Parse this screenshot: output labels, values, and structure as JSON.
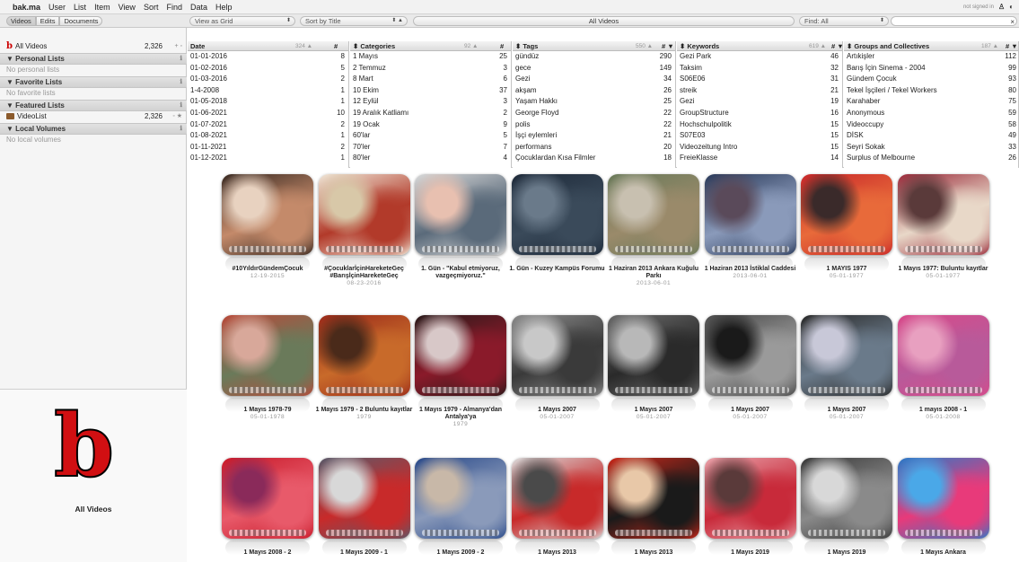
{
  "menubar": {
    "app": "bak.ma",
    "menus": [
      "User",
      "List",
      "Item",
      "View",
      "Sort",
      "Find",
      "Data",
      "Help"
    ],
    "status": "not signed in"
  },
  "toolbar": {
    "tabs": [
      "Videos",
      "Edits",
      "Documents"
    ],
    "view_select": "View as Grid",
    "sort_select": "Sort by Title",
    "list_title": "All Videos",
    "find_select": "Find: All"
  },
  "sidebar": {
    "all_videos": {
      "label": "All Videos",
      "count": "2,326"
    },
    "personal_header": "Personal Lists",
    "personal_empty": "No personal lists",
    "favorite_header": "Favorite Lists",
    "favorite_empty": "No favorite lists",
    "featured_header": "Featured Lists",
    "videolist": {
      "label": "VideoList",
      "count": "2,326"
    },
    "volumes_header": "Local Volumes",
    "volumes_empty": "No local volumes",
    "preview_letter": "b",
    "preview_caption": "All Videos"
  },
  "browser": {
    "columns": [
      {
        "title": "Date",
        "total": "324",
        "rows": [
          {
            "label": "01-01-2016",
            "count": "8"
          },
          {
            "label": "01-02-2016",
            "count": "5"
          },
          {
            "label": "01-03-2016",
            "count": "2"
          },
          {
            "label": "1-4-2008",
            "count": "1"
          },
          {
            "label": "01-05-2018",
            "count": "1"
          },
          {
            "label": "01-06-2021",
            "count": "10"
          },
          {
            "label": "01-07-2021",
            "count": "2"
          },
          {
            "label": "01-08-2021",
            "count": "1"
          },
          {
            "label": "01-11-2021",
            "count": "2"
          },
          {
            "label": "01-12-2021",
            "count": "1"
          }
        ]
      },
      {
        "title": "Categories",
        "total": "92",
        "rows": [
          {
            "label": "1 Mayıs",
            "count": "25"
          },
          {
            "label": "2 Temmuz",
            "count": "3"
          },
          {
            "label": "8 Mart",
            "count": "6"
          },
          {
            "label": "10 Ekim",
            "count": "37"
          },
          {
            "label": "12 Eylül",
            "count": "3"
          },
          {
            "label": "19 Aralık Katliamı",
            "count": "2"
          },
          {
            "label": "19 Ocak",
            "count": "9"
          },
          {
            "label": "60'lar",
            "count": "5"
          },
          {
            "label": "70'ler",
            "count": "7"
          },
          {
            "label": "80'ler",
            "count": "4"
          }
        ]
      },
      {
        "title": "Tags",
        "total": "550",
        "rows": [
          {
            "label": "gündüz",
            "count": "290"
          },
          {
            "label": "gece",
            "count": "149"
          },
          {
            "label": "Gezi",
            "count": "34"
          },
          {
            "label": "akşam",
            "count": "26"
          },
          {
            "label": "Yaşam Hakkı",
            "count": "25"
          },
          {
            "label": "George Floyd",
            "count": "22"
          },
          {
            "label": "polis",
            "count": "22"
          },
          {
            "label": "İşçi eylemleri",
            "count": "21"
          },
          {
            "label": "performans",
            "count": "20"
          },
          {
            "label": "Çocuklardan Kısa Filmler",
            "count": "18"
          }
        ]
      },
      {
        "title": "Keywords",
        "total": "619",
        "rows": [
          {
            "label": "Gezi Park",
            "count": "46"
          },
          {
            "label": "Taksim",
            "count": "32"
          },
          {
            "label": "S06E06",
            "count": "31"
          },
          {
            "label": "streik",
            "count": "21"
          },
          {
            "label": "Gezi",
            "count": "19"
          },
          {
            "label": "GroupStructure",
            "count": "16"
          },
          {
            "label": "Hochschulpolitik",
            "count": "15"
          },
          {
            "label": "S07E03",
            "count": "15"
          },
          {
            "label": "Videozeitung Intro",
            "count": "15"
          },
          {
            "label": "FreieKlasse",
            "count": "14"
          }
        ]
      },
      {
        "title": "Groups and Collectives",
        "total": "187",
        "rows": [
          {
            "label": "Artıkişler",
            "count": "112"
          },
          {
            "label": "Barış İçin Sinema - 2004",
            "count": "99"
          },
          {
            "label": "Gündem Çocuk",
            "count": "93"
          },
          {
            "label": "Tekel İşçileri / Tekel Workers",
            "count": "80"
          },
          {
            "label": "Karahaber",
            "count": "75"
          },
          {
            "label": "Anonymous",
            "count": "59"
          },
          {
            "label": "Videoccupy",
            "count": "58"
          },
          {
            "label": "DİSK",
            "count": "49"
          },
          {
            "label": "Seyri Sokak",
            "count": "33"
          },
          {
            "label": "Surplus of Melbourne",
            "count": "26"
          }
        ]
      }
    ]
  },
  "grid": {
    "items": [
      {
        "title": "#10YıldırGündemÇocuk",
        "date": "12-19-2015",
        "colors": [
          "#3a2a22",
          "#c48a6a",
          "#e8d2c0"
        ]
      },
      {
        "title": "#ÇocuklarİçinHareketeGeç #BarışİçinHareketeGeç",
        "date": "08-23-2016",
        "colors": [
          "#efe6d6",
          "#b23a2a",
          "#d8c8a8"
        ]
      },
      {
        "title": "1. Gün - \"Kabul etmiyoruz, vazgeçmiyoruz.\"",
        "date": "",
        "colors": [
          "#d8d8d8",
          "#5a6a7a",
          "#e8c0b0"
        ]
      },
      {
        "title": "1. Gün - Kuzey Kampüs Forumu",
        "date": "",
        "colors": [
          "#1e2a3a",
          "#3a4a5a",
          "#6a7a8a"
        ]
      },
      {
        "title": "1 Haziran 2013 Ankara Kuğulu Parkı",
        "date": "2013-06-01",
        "colors": [
          "#6a7a5a",
          "#9a8a6a",
          "#c8c0b0"
        ]
      },
      {
        "title": "1 Haziran 2013 İstiklal Caddesi",
        "date": "2013-06-01",
        "colors": [
          "#2a3a5a",
          "#8a9aba",
          "#5a4a5a"
        ]
      },
      {
        "title": "1 MAYIS 1977",
        "date": "05-01-1977",
        "colors": [
          "#c8282a",
          "#e86a3a",
          "#3a2a2a"
        ]
      },
      {
        "title": "1 Mayıs 1977: Buluntu kayıtlar",
        "date": "05-01-1977",
        "colors": [
          "#9a2a3a",
          "#e8d8c8",
          "#5a3a3a"
        ]
      },
      {
        "title": "1 Mayıs 1978-79",
        "date": "05-01-1978",
        "colors": [
          "#b84a3a",
          "#6a7a5a",
          "#d8a89a"
        ]
      },
      {
        "title": "1 Mayıs 1979 - 2 Buluntu kayıtlar",
        "date": "1979",
        "colors": [
          "#9a2a1a",
          "#c86a2a",
          "#4a2a1a"
        ]
      },
      {
        "title": "1 Mayıs 1979 - Almanya'dan Antalya'ya",
        "date": "1979",
        "colors": [
          "#2a1a1a",
          "#8a1a2a",
          "#d8c8c8"
        ]
      },
      {
        "title": "1 Mayıs 2007",
        "date": "05-01-2007",
        "colors": [
          "#8a8a8a",
          "#3a3a3a",
          "#c8c8c8"
        ]
      },
      {
        "title": "1 Mayıs 2007",
        "date": "05-01-2007",
        "colors": [
          "#6a6a6a",
          "#2a2a2a",
          "#b8b8b8"
        ]
      },
      {
        "title": "1 Mayıs 2007",
        "date": "05-01-2007",
        "colors": [
          "#4a4a4a",
          "#9a9a9a",
          "#1a1a1a"
        ]
      },
      {
        "title": "1 Mayıs 2007",
        "date": "05-01-2007",
        "colors": [
          "#2a2a2a",
          "#6a7a8a",
          "#c8c8d8"
        ]
      },
      {
        "title": "1 mayıs 2008 - 1",
        "date": "05-01-2008",
        "colors": [
          "#d84a8a",
          "#b85a9a",
          "#e8a0c0"
        ]
      },
      {
        "title": "1 Mayıs 2008 - 2",
        "date": "",
        "colors": [
          "#c81a2a",
          "#e85a6a",
          "#8a2a5a"
        ]
      },
      {
        "title": "1 Mayıs 2009 - 1",
        "date": "",
        "colors": [
          "#5a5a6a",
          "#c82a2a",
          "#d8d8d8"
        ]
      },
      {
        "title": "1 Mayıs 2009 - 2",
        "date": "",
        "colors": [
          "#2a4a8a",
          "#8a9aba",
          "#c8b8a8"
        ]
      },
      {
        "title": "1 Mayıs 2013",
        "date": "",
        "colors": [
          "#d8d8d8",
          "#c82a2a",
          "#4a4a4a"
        ]
      },
      {
        "title": "1 Mayıs 2013",
        "date": "",
        "colors": [
          "#c8281a",
          "#1a1a1a",
          "#e8c8a8"
        ]
      },
      {
        "title": "1 Mayıs 2019",
        "date": "",
        "colors": [
          "#e8a0a8",
          "#c82a3a",
          "#5a3a3a"
        ]
      },
      {
        "title": "1 Mayıs 2019",
        "date": "",
        "colors": [
          "#3a3a3a",
          "#8a8a8a",
          "#d8d8d8"
        ]
      },
      {
        "title": "1 Mayıs Ankara",
        "date": "",
        "colors": [
          "#2a7ac8",
          "#e83a7a",
          "#4aa8e8"
        ]
      }
    ]
  },
  "colors": {
    "brand_red": "#d10f12",
    "sidebar_bg": "#f5f5f5",
    "header_bg": "#dcdcdc"
  }
}
